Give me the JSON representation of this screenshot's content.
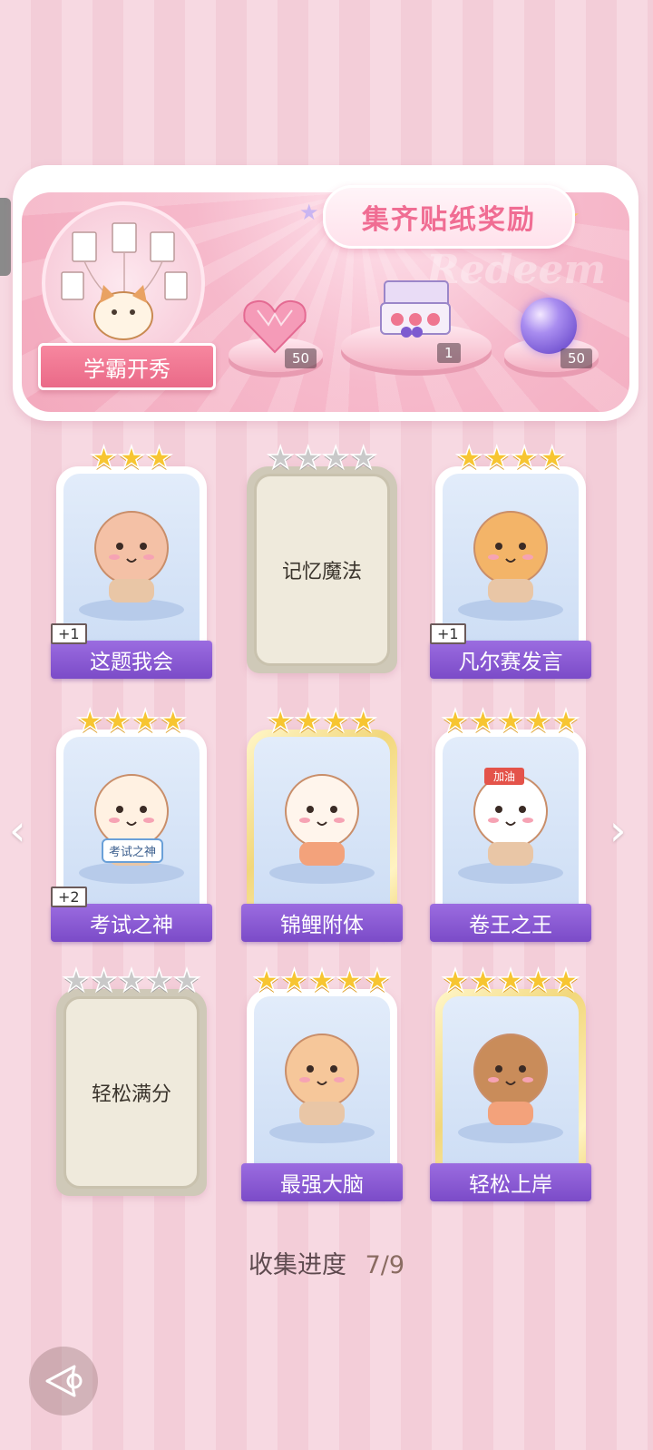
{
  "banner": {
    "title": "集齐贴纸奖励",
    "watermark": "Redeem",
    "featured_label": "学霸开秀",
    "rewards": [
      {
        "name": "pink-heart-gem",
        "count": "50"
      },
      {
        "name": "gift-box",
        "count": "1"
      },
      {
        "name": "purple-energy-orb",
        "count": "50"
      }
    ]
  },
  "cards": [
    {
      "label": "这题我会",
      "stars": 3,
      "filled": 3,
      "state": "collected",
      "badge": "+1"
    },
    {
      "label": "记忆魔法",
      "stars": 4,
      "filled": 0,
      "state": "locked",
      "badge": ""
    },
    {
      "label": "凡尔赛发言",
      "stars": 4,
      "filled": 4,
      "state": "collected",
      "badge": "+1"
    },
    {
      "label": "考试之神",
      "stars": 4,
      "filled": 4,
      "state": "collected",
      "badge": "+2"
    },
    {
      "label": "锦鲤附体",
      "stars": 4,
      "filled": 4,
      "state": "gold",
      "badge": ""
    },
    {
      "label": "卷王之王",
      "stars": 5,
      "filled": 5,
      "state": "collected",
      "badge": ""
    },
    {
      "label": "轻松满分",
      "stars": 5,
      "filled": 0,
      "state": "locked",
      "badge": ""
    },
    {
      "label": "最强大脑",
      "stars": 5,
      "filled": 5,
      "state": "collected",
      "badge": ""
    },
    {
      "label": "轻松上岸",
      "stars": 5,
      "filled": 5,
      "state": "gold",
      "badge": ""
    }
  ],
  "progress": {
    "label": "收集进度",
    "value": "7/9"
  },
  "art_texts": {
    "exam_sign": "考试之神",
    "headband": "加油"
  },
  "colors": {
    "accent": "#8b5ad6",
    "title_pink": "#f06d93",
    "star_gold": "#f7c531"
  },
  "icons": {
    "back": "back-arrow-icon",
    "prev": "chevron-left-icon",
    "next": "chevron-right-icon"
  }
}
